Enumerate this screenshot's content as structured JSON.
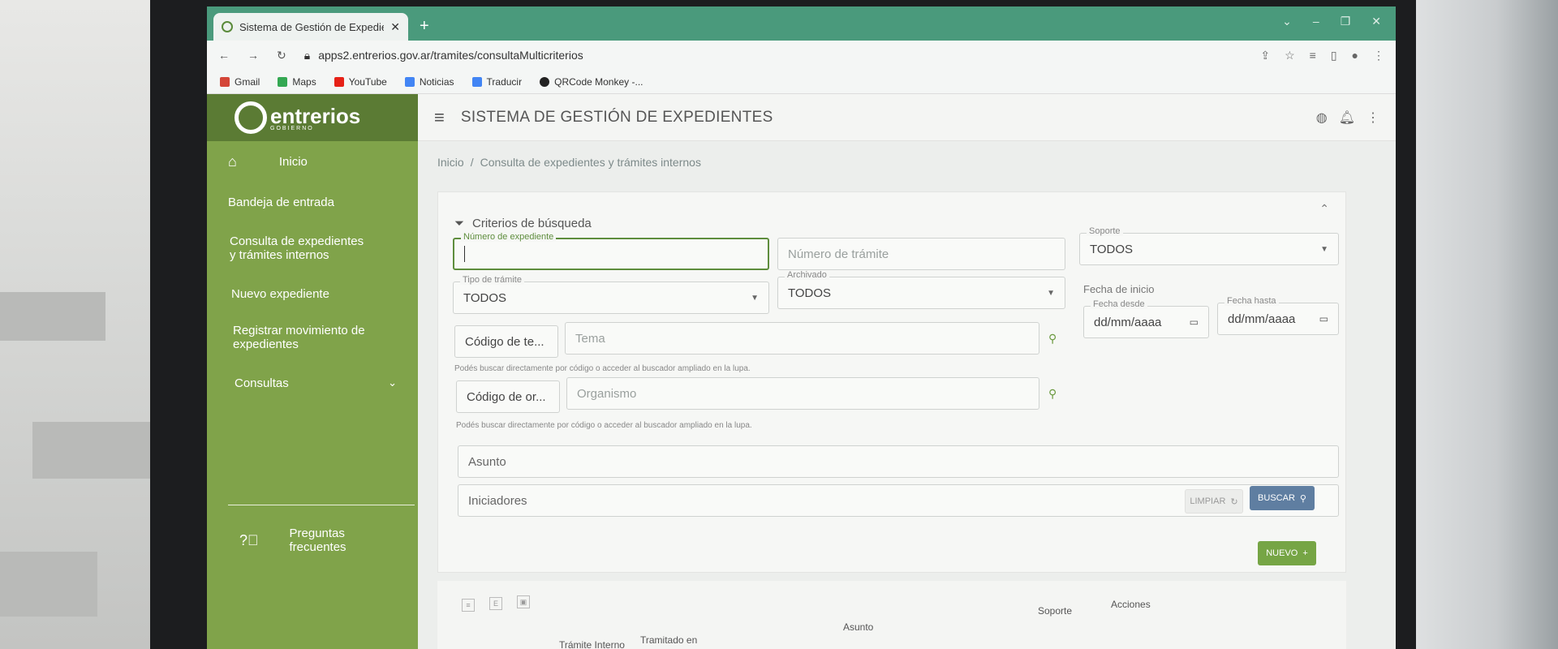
{
  "browser": {
    "tab_title": "Sistema de Gestión de Expedien",
    "new_tab": "+",
    "url": "apps2.entrerios.gov.ar/tramites/consultaMulticriterios",
    "bookmarks": [
      {
        "label": "Gmail",
        "color": "#d44638"
      },
      {
        "label": "Maps",
        "color": "#34a853"
      },
      {
        "label": "YouTube",
        "color": "#e62117"
      },
      {
        "label": "Noticias",
        "color": "#4285f4"
      },
      {
        "label": "Traducir",
        "color": "#4285f4"
      },
      {
        "label": "QRCode Monkey -...",
        "color": "#222222"
      }
    ]
  },
  "brand": {
    "name": "entrerios",
    "sub": "GOBIERNO"
  },
  "sidebar": {
    "items": [
      {
        "label": "Inicio"
      },
      {
        "label": "Bandeja de entrada"
      },
      {
        "label": "Consulta de expedientes y trámites internos"
      },
      {
        "label": "Nuevo expediente"
      },
      {
        "label": "Registrar movimiento de expedientes"
      },
      {
        "label": "Consultas"
      }
    ],
    "faq": "Preguntas frecuentes"
  },
  "header": {
    "title": "SISTEMA DE GESTIÓN DE EXPEDIENTES"
  },
  "breadcrumb": {
    "home": "Inicio",
    "separator": "/",
    "current": "Consulta de expedientes y trámites internos"
  },
  "search": {
    "title": "Criterios de búsqueda",
    "numero_expediente_label": "Número de expediente",
    "numero_tramite_placeholder": "Número de trámite",
    "soporte_label": "Soporte",
    "soporte_value": "TODOS",
    "tipo_tramite_label": "Tipo de trámite",
    "tipo_tramite_value": "TODOS",
    "archivado_label": "Archivado",
    "archivado_value": "TODOS",
    "fecha_inicio_label": "Fecha de inicio",
    "fecha_desde_label": "Fecha desde",
    "fecha_desde_value": "dd/mm/aaaa",
    "fecha_hasta_label": "Fecha hasta",
    "fecha_hasta_value": "dd/mm/aaaa",
    "codigo_tema": "Código de te...",
    "tema_placeholder": "Tema",
    "hint_tema": "Podés buscar directamente por código o acceder al buscador ampliado en la lupa.",
    "codigo_organismo": "Código de or...",
    "organismo_placeholder": "Organismo",
    "hint_organismo": "Podés buscar directamente por código o acceder al buscador ampliado en la lupa.",
    "asunto_placeholder": "Asunto",
    "iniciadores_placeholder": "Iniciadores",
    "limpiar": "LIMPIAR",
    "buscar": "BUSCAR",
    "nuevo": "NUEVO"
  },
  "table": {
    "headers": [
      "Trámite Interno",
      "Tramitado en",
      "Asunto",
      "Soporte",
      "Acciones"
    ]
  },
  "colors": {
    "sidebar": "#80a34a",
    "brand": "#5b7b34",
    "accent": "#5e8d3d",
    "buscar": "#5f7ea1",
    "nuevo": "#76a545"
  },
  "icons": {
    "menu": "hamburger-icon",
    "filter": "filter-icon",
    "search": "search-icon",
    "home": "home-icon",
    "help": "help-icon",
    "globe": "globe-icon",
    "bell": "bell-icon",
    "calendar": "calendar-icon"
  }
}
